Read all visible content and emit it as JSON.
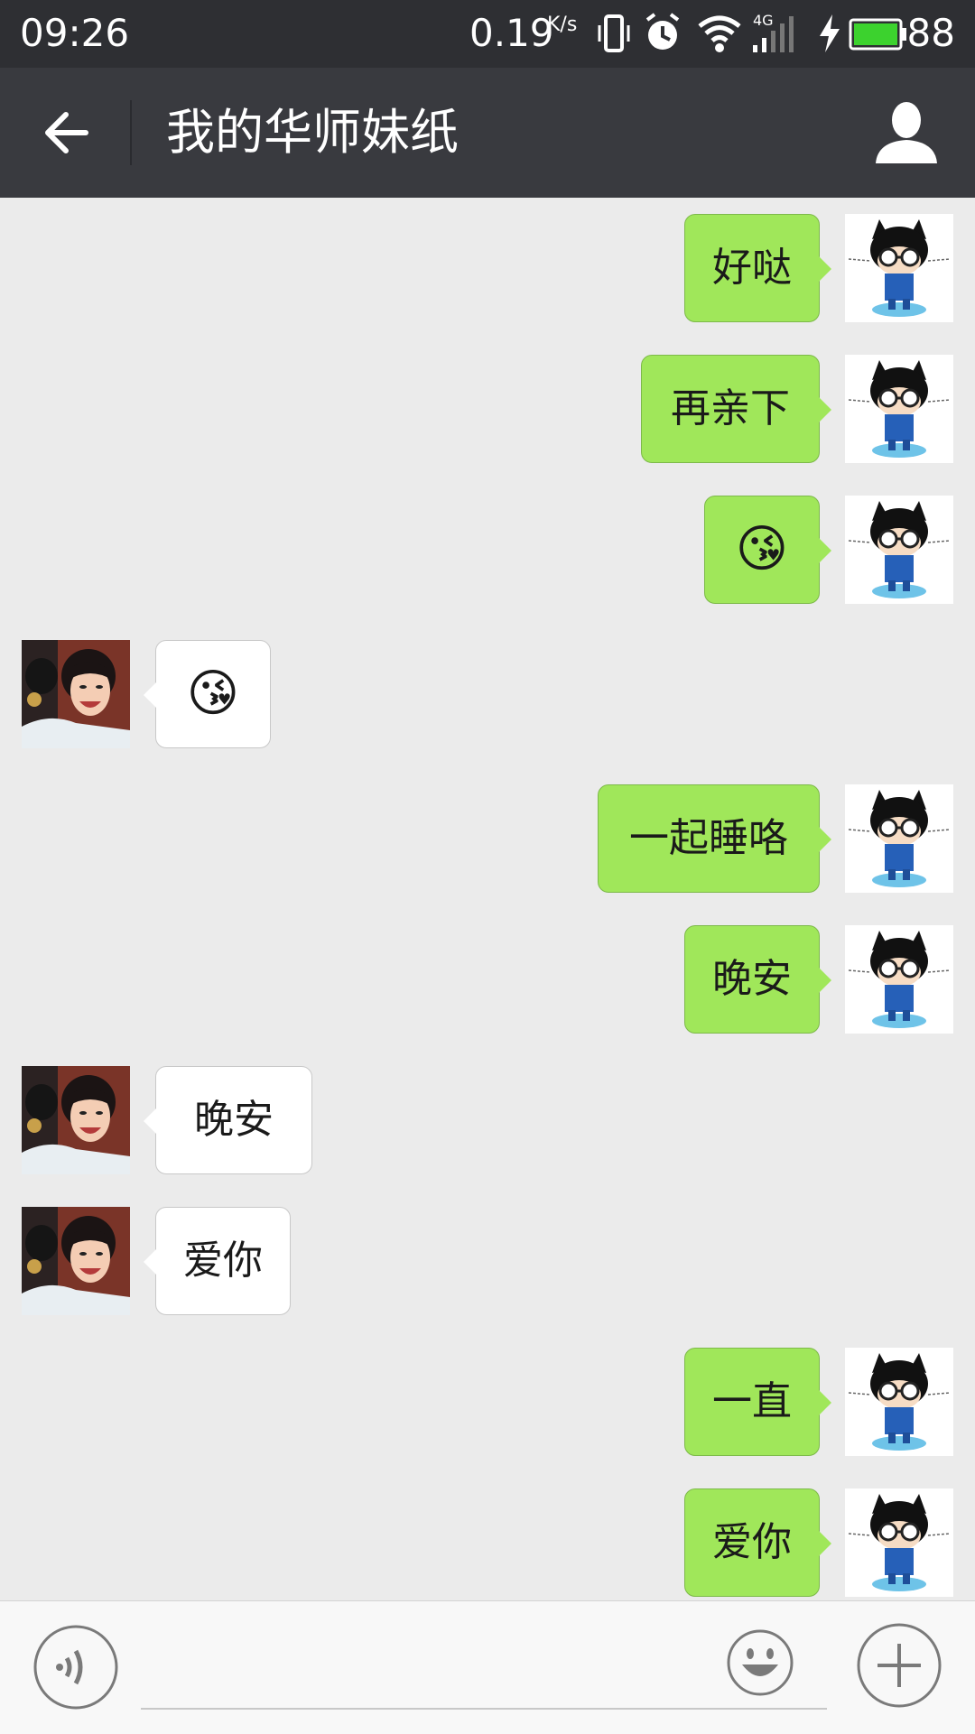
{
  "status_bar": {
    "time": "09:26",
    "net_speed": "0.19",
    "net_unit": "K/s",
    "network_label": "4G",
    "battery_level": "88"
  },
  "header": {
    "title": "我的华师妹纸"
  },
  "messages": [
    {
      "sender": "me",
      "text": "好哒"
    },
    {
      "sender": "me",
      "text": "再亲下"
    },
    {
      "sender": "me",
      "text": "😘"
    },
    {
      "sender": "her",
      "text": "😘"
    },
    {
      "sender": "me",
      "text": "一起睡咯"
    },
    {
      "sender": "me",
      "text": "晚安"
    },
    {
      "sender": "her",
      "text": "晚安"
    },
    {
      "sender": "her",
      "text": "爱你"
    },
    {
      "sender": "me",
      "text": "一直"
    },
    {
      "sender": "me",
      "text": "爱你"
    }
  ],
  "input": {
    "placeholder": ""
  },
  "colors": {
    "status_bar": "#2e2f33",
    "header": "#393a3f",
    "chat_bg": "#ebebeb",
    "my_bubble": "#a0e75a",
    "her_bubble": "#ffffff",
    "battery": "#3cd22e"
  },
  "icons": [
    "back-arrow-icon",
    "profile-icon",
    "voice-icon",
    "emoji-icon",
    "plus-icon",
    "vibrate-icon",
    "alarm-icon",
    "wifi-icon",
    "signal-icon",
    "charging-icon",
    "battery-icon"
  ]
}
